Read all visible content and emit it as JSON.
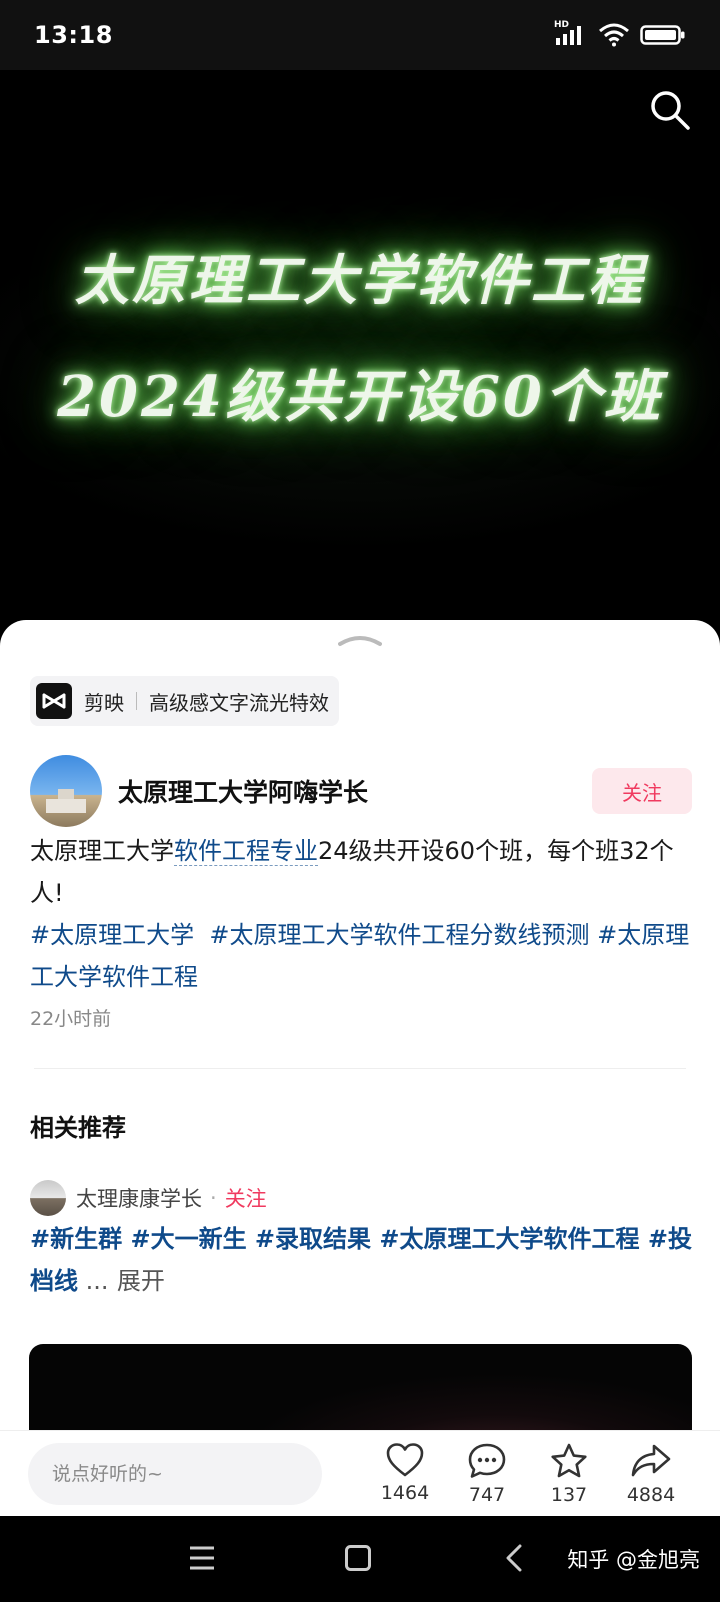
{
  "status_bar": {
    "time": "13:18",
    "network": "HD"
  },
  "video": {
    "overlay_line1": "太原理工大学软件工程",
    "overlay_line2": "2024级共开设60个班"
  },
  "effect_chip": {
    "app": "剪映",
    "effect": "高级感文字流光特效"
  },
  "author": {
    "name": "太原理工大学阿嗨学长",
    "follow_label": "关注"
  },
  "post": {
    "desc_prefix": "太原理工大学",
    "desc_link": "软件工程专业",
    "desc_suffix": "24级共开设60个班，每个班32个人!",
    "hashtags": [
      "#太原理工大学",
      "#太原理工大学软件工程分数线预测",
      "#太原理工大学软件工程"
    ],
    "time_ago": "22小时前"
  },
  "related": {
    "title": "相关推荐",
    "item": {
      "author": "太理康康学长",
      "dot": "·",
      "follow_label": "关注",
      "tags": "#新生群 #大一新生 #录取结果 #太原理工大学软件工程 #投档线",
      "ellipsis": " ...",
      "expand_label": "展开"
    }
  },
  "action_bar": {
    "comment_placeholder": "说点好听的~",
    "like_count": "1464",
    "comment_count": "747",
    "favorite_count": "137",
    "share_count": "4884"
  },
  "watermark": "知乎 @金旭亮",
  "colors": {
    "accent_pink": "#f03a5f",
    "link_blue": "#0f4a8a"
  }
}
